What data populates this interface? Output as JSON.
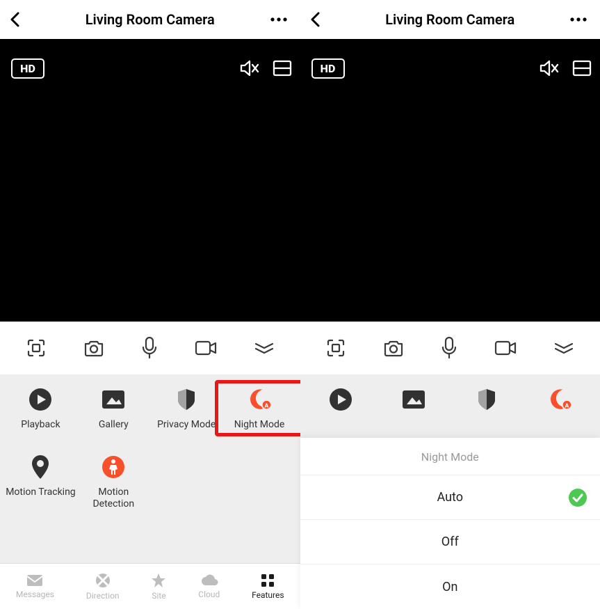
{
  "left": {
    "header": {
      "title": "Living Room Camera"
    },
    "video": {
      "quality_badge": "HD"
    },
    "features": {
      "playback": "Playback",
      "gallery": "Gallery",
      "privacy": "Privacy Mode",
      "night": "Night Mode",
      "tracking": "Motion Tracking",
      "detection": "Motion Detection"
    },
    "nav": {
      "messages": "Messages",
      "direction": "Direction",
      "site": "Site",
      "cloud": "Cloud",
      "features": "Features"
    }
  },
  "right": {
    "header": {
      "title": "Living Room Camera"
    },
    "video": {
      "quality_badge": "HD"
    },
    "sheet": {
      "title": "Night Mode",
      "options": {
        "auto": "Auto",
        "off": "Off",
        "on": "On"
      },
      "selected": "auto"
    }
  },
  "colors": {
    "accent": "#F94F2A",
    "highlight": "#E71818",
    "success": "#4CC853"
  }
}
